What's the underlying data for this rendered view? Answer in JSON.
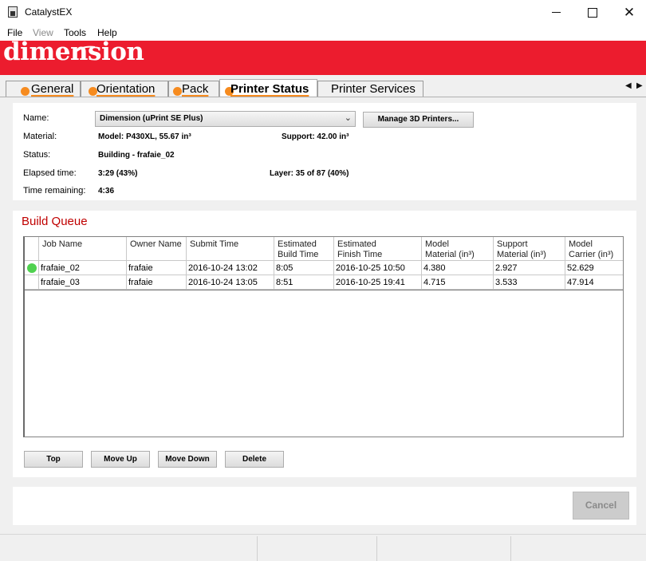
{
  "window": {
    "title": "CatalystEX"
  },
  "menu": [
    "File",
    "View",
    "Tools",
    "Help"
  ],
  "brand": {
    "logo_text": "dimension",
    "color": "#ec1c2e"
  },
  "tabs": [
    {
      "label": "General",
      "active": false
    },
    {
      "label": "Orientation",
      "active": false
    },
    {
      "label": "Pack",
      "active": false
    },
    {
      "label": "Printer Status",
      "active": true
    },
    {
      "label": "Printer Services",
      "active": false
    }
  ],
  "printer_info": {
    "name_label": "Name:",
    "name_value": "Dimension  (uPrint SE Plus)",
    "manage_button": "Manage 3D Printers...",
    "material_label": "Material:",
    "model_value": "Model:  P430XL, 55.67 in³",
    "support_value": "Support:  42.00 in³",
    "status_label": "Status:",
    "status_value": "Building - frafaie_02",
    "elapsed_label": "Elapsed time:",
    "elapsed_value": "3:29  (43%)",
    "layer_value": "Layer:  35 of 87  (40%)",
    "remaining_label": "Time remaining:",
    "remaining_value": "4:36"
  },
  "build_queue": {
    "title": "Build Queue",
    "columns": [
      "Job Name",
      "Owner Name",
      "Submit Time",
      "Estimated\nBuild Time",
      "Estimated\nFinish Time",
      "Model\nMaterial (in³)",
      "Support\nMaterial (in³)",
      "Model\nCarrier (in³)"
    ],
    "rows": [
      {
        "active": true,
        "cells": [
          "frafaie_02",
          "frafaie",
          "2016-10-24 13:02",
          "8:05",
          "2016-10-25 10:50",
          "4.380",
          "2.927",
          "52.629"
        ]
      },
      {
        "active": false,
        "cells": [
          "frafaie_03",
          "frafaie",
          "2016-10-24 13:05",
          "8:51",
          "2016-10-25 19:41",
          "4.715",
          "3.533",
          "47.914"
        ]
      }
    ],
    "buttons": {
      "top": "Top",
      "move_up": "Move Up",
      "move_down": "Move Down",
      "delete": "Delete"
    }
  },
  "footer": {
    "cancel_button": "Cancel"
  }
}
